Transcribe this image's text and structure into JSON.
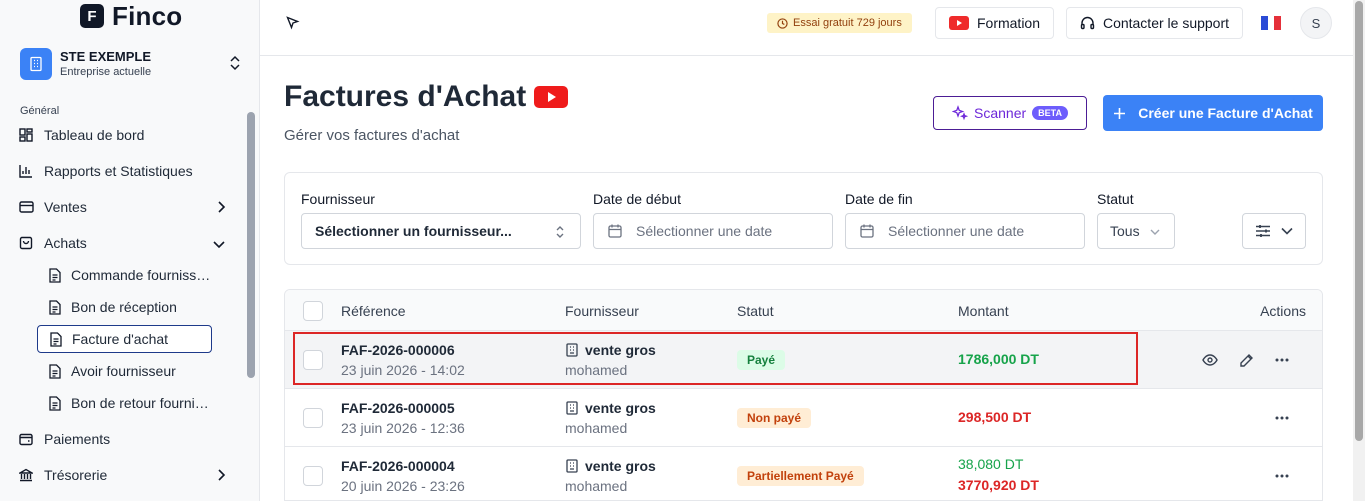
{
  "brand": {
    "logo_letter": "F",
    "name": "Finco"
  },
  "company": {
    "name": "STE EXEMPLE",
    "subtitle": "Entreprise actuelle"
  },
  "sidebar": {
    "section_label": "Général",
    "items": [
      {
        "label": "Tableau de bord"
      },
      {
        "label": "Rapports et Statistiques"
      },
      {
        "label": "Ventes"
      },
      {
        "label": "Achats"
      }
    ],
    "sub_items": [
      {
        "label": "Commande fournisseur"
      },
      {
        "label": "Bon de réception"
      },
      {
        "label": "Facture d'achat"
      },
      {
        "label": "Avoir fournisseur"
      },
      {
        "label": "Bon de retour fournisseur"
      }
    ],
    "bottom_items": [
      {
        "label": "Paiements"
      },
      {
        "label": "Trésorerie"
      }
    ]
  },
  "header": {
    "trial_badge": "Essai gratuit 729 jours",
    "formation_label": "Formation",
    "support_label": "Contacter le support",
    "avatar_initial": "S"
  },
  "page": {
    "title": "Factures d'Achat",
    "subtitle": "Gérer vos factures d'achat",
    "scanner_label": "Scanner",
    "beta_label": "BETA",
    "create_label": "Créer une Facture d'Achat"
  },
  "filters": {
    "supplier_label": "Fournisseur",
    "supplier_placeholder": "Sélectionner un fournisseur...",
    "start_label": "Date de début",
    "start_placeholder": "Sélectionner une date",
    "end_label": "Date de fin",
    "end_placeholder": "Sélectionner une date",
    "status_label": "Statut",
    "status_value": "Tous"
  },
  "table": {
    "columns": {
      "reference": "Référence",
      "supplier": "Fournisseur",
      "status": "Statut",
      "amount": "Montant",
      "actions": "Actions"
    },
    "rows": [
      {
        "reference": "FAF-2026-000006",
        "date": "23 juin 2026 - 14:02",
        "supplier": "vente gros",
        "contact": "mohamed",
        "status": "Payé",
        "amount": "1786,000 DT",
        "amount_extra": ""
      },
      {
        "reference": "FAF-2026-000005",
        "date": "23 juin 2026 - 12:36",
        "supplier": "vente gros",
        "contact": "mohamed",
        "status": "Non payé",
        "amount": "298,500 DT",
        "amount_extra": ""
      },
      {
        "reference": "FAF-2026-000004",
        "date": "20 juin 2026 - 23:26",
        "supplier": "vente gros",
        "contact": "mohamed",
        "status": "Partiellement Payé",
        "amount": "38,080 DT",
        "amount_extra": "3770,920 DT"
      }
    ]
  },
  "colors": {
    "accent": "#3b82f6",
    "paid_green": "#16a34a",
    "unpaid_red": "#dc2626",
    "highlight_box": "#dc2626",
    "scanner_purple": "#6d28d9"
  }
}
